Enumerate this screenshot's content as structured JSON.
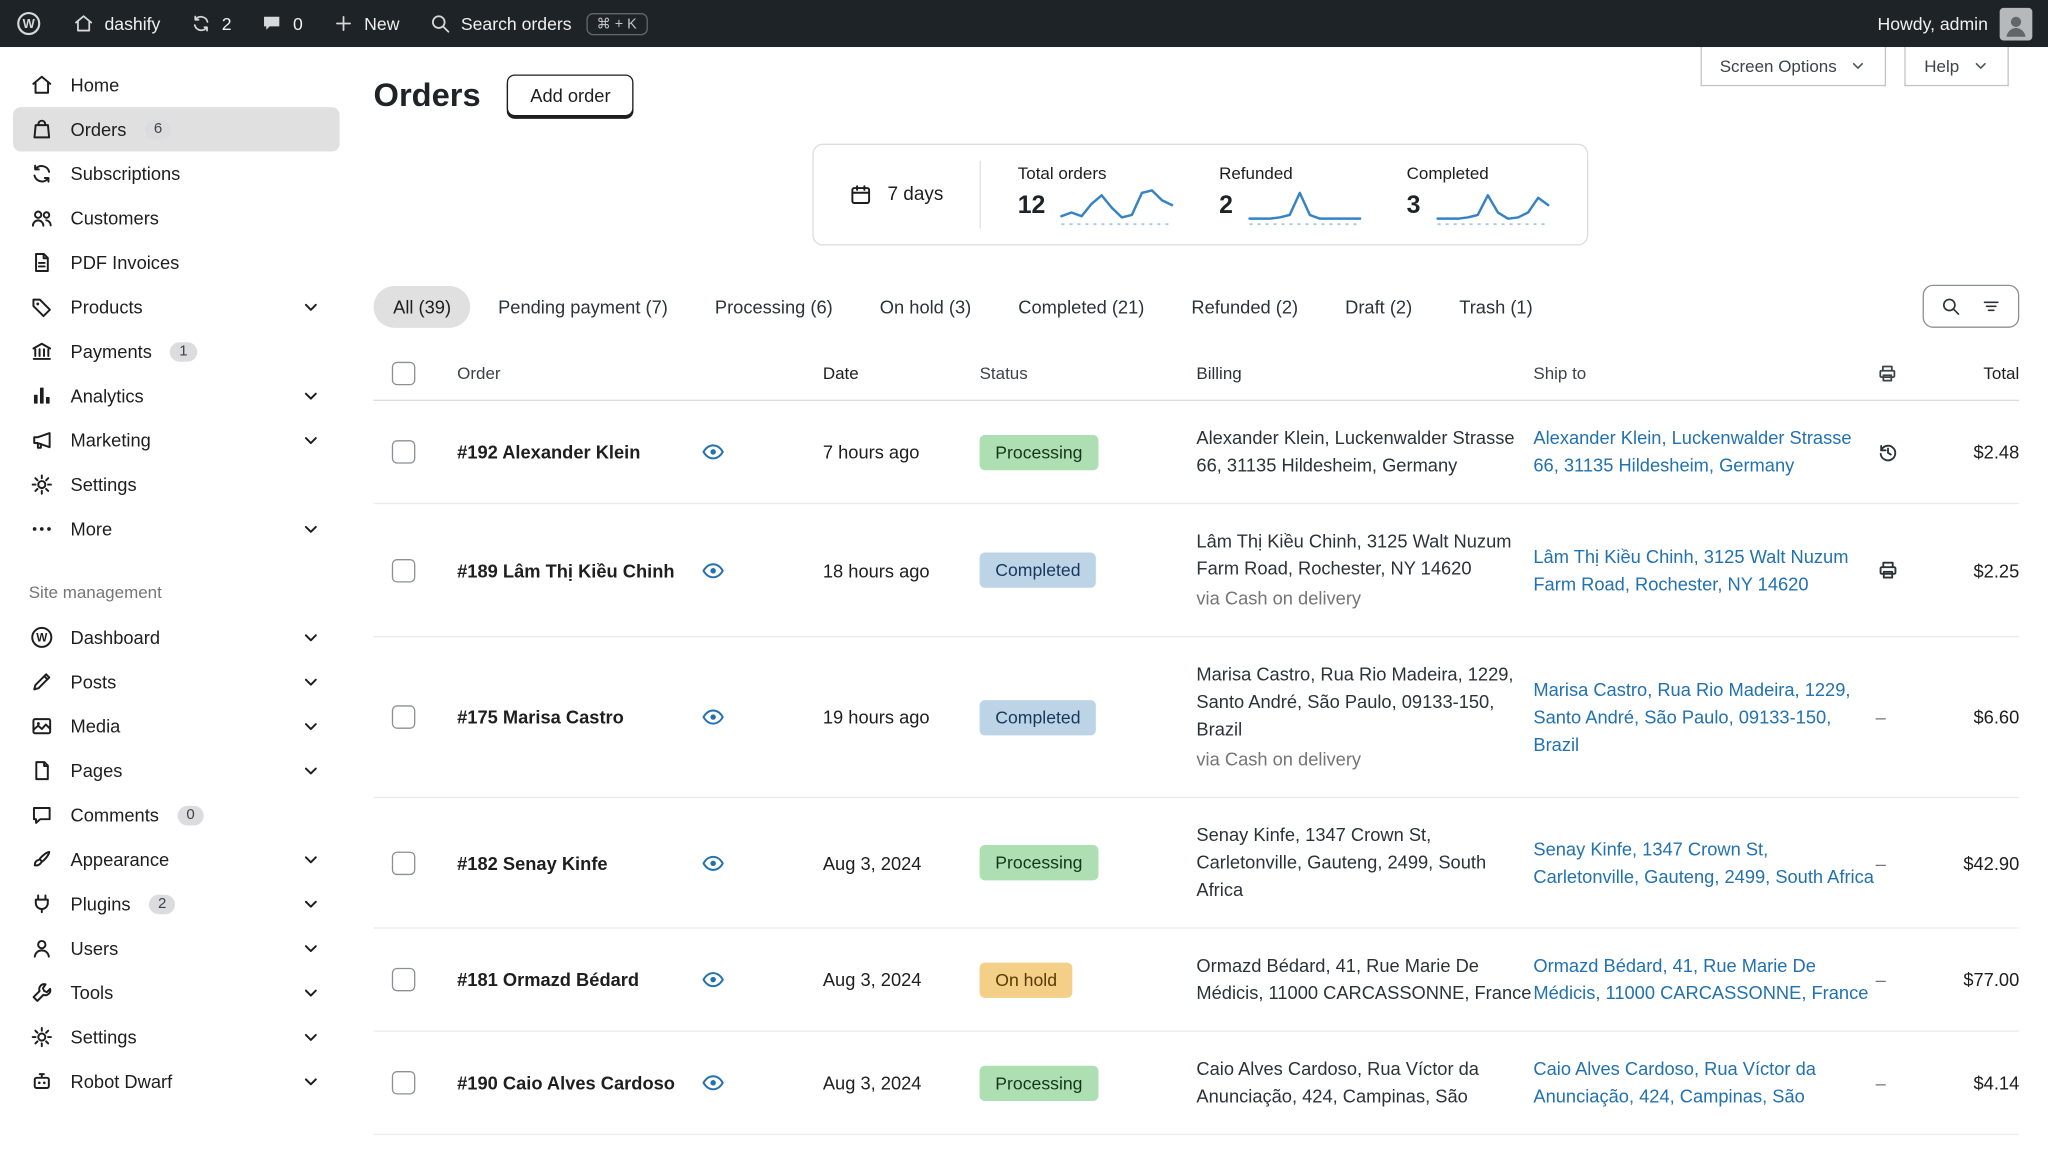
{
  "admin_bar": {
    "site_name": "dashify",
    "updates_count": "2",
    "comments_count": "0",
    "new_label": "New",
    "search_label": "Search orders",
    "search_shortcut": "⌘ + K",
    "howdy_label": "Howdy, admin"
  },
  "sidebar": {
    "items": [
      {
        "label": "Home",
        "icon": "home"
      },
      {
        "label": "Orders",
        "icon": "orders",
        "badge": "6",
        "active": true
      },
      {
        "label": "Subscriptions",
        "icon": "subscriptions"
      },
      {
        "label": "Customers",
        "icon": "customers"
      },
      {
        "label": "PDF Invoices",
        "icon": "pdf-invoices"
      },
      {
        "label": "Products",
        "icon": "products",
        "chevron": true
      },
      {
        "label": "Payments",
        "icon": "payments",
        "badge": "1"
      },
      {
        "label": "Analytics",
        "icon": "analytics",
        "chevron": true
      },
      {
        "label": "Marketing",
        "icon": "marketing",
        "chevron": true
      },
      {
        "label": "Settings",
        "icon": "settings"
      },
      {
        "label": "More",
        "icon": "more",
        "chevron": true
      }
    ],
    "section_label": "Site management",
    "site_items": [
      {
        "label": "Dashboard",
        "icon": "wordpress",
        "chevron": true
      },
      {
        "label": "Posts",
        "icon": "posts",
        "chevron": true
      },
      {
        "label": "Media",
        "icon": "media",
        "chevron": true
      },
      {
        "label": "Pages",
        "icon": "pages",
        "chevron": true
      },
      {
        "label": "Comments",
        "icon": "comments",
        "badge": "0"
      },
      {
        "label": "Appearance",
        "icon": "appearance",
        "chevron": true
      },
      {
        "label": "Plugins",
        "icon": "plugins",
        "badge": "2",
        "chevron": true
      },
      {
        "label": "Users",
        "icon": "users",
        "chevron": true
      },
      {
        "label": "Tools",
        "icon": "tools",
        "chevron": true
      },
      {
        "label": "Settings",
        "icon": "settings",
        "chevron": true
      },
      {
        "label": "Robot Dwarf",
        "icon": "robot",
        "chevron": true
      }
    ]
  },
  "header": {
    "title": "Orders",
    "add_order_label": "Add order",
    "screen_options_label": "Screen Options",
    "help_label": "Help"
  },
  "stats": {
    "period_label": "7 days",
    "spark_color": "#3582c4",
    "baseline_color": "#a8c8e8",
    "cards": [
      {
        "label": "Total orders",
        "value": "12",
        "spark": [
          25,
          22,
          25,
          15,
          8,
          18,
          26,
          24,
          6,
          4,
          12,
          16
        ]
      },
      {
        "label": "Refunded",
        "value": "2",
        "spark": [
          27,
          27,
          27,
          26,
          24,
          6,
          24,
          27,
          27,
          27,
          27,
          27
        ]
      },
      {
        "label": "Completed",
        "value": "3",
        "spark": [
          27,
          27,
          27,
          26,
          24,
          8,
          22,
          27,
          26,
          22,
          10,
          16
        ]
      }
    ]
  },
  "filters": {
    "tabs": [
      {
        "label": "All (39)",
        "active": true
      },
      {
        "label": "Pending payment (7)"
      },
      {
        "label": "Processing (6)"
      },
      {
        "label": "On hold (3)"
      },
      {
        "label": "Completed (21)"
      },
      {
        "label": "Refunded (2)"
      },
      {
        "label": "Draft (2)"
      },
      {
        "label": "Trash (1)"
      }
    ]
  },
  "status_colors": {
    "processing": {
      "bg": "#aedfb2",
      "fg": "#14361a"
    },
    "completed": {
      "bg": "#bdd4e7",
      "fg": "#17385c"
    },
    "on-hold": {
      "bg": "#f3cf87",
      "fg": "#573b00"
    }
  },
  "table": {
    "empty_cell": "–",
    "headers": {
      "order": "Order",
      "date": "Date",
      "status": "Status",
      "billing": "Billing",
      "ship_to": "Ship to",
      "total": "Total"
    },
    "rows": [
      {
        "order": "#192 Alexander Klein",
        "date": "7 hours ago",
        "status": "Processing",
        "status_key": "processing",
        "billing": "Alexander Klein, Luckenwalder Strasse 66, 31135 Hildesheim, Germany",
        "billing_note": "",
        "ship_to": "Alexander Klein, Luckenwalder Strasse 66, 31135 Hildesheim, Germany",
        "doc_icon": "history",
        "total": "$2.48"
      },
      {
        "order": "#189 Lâm Thị Kiều Chinh",
        "date": "18 hours ago",
        "status": "Completed",
        "status_key": "completed",
        "billing": "Lâm Thị Kiều Chinh, 3125 Walt Nuzum Farm Road, Rochester, NY 14620",
        "billing_note": "via Cash on delivery",
        "ship_to": "Lâm Thị Kiều Chinh, 3125 Walt Nuzum Farm Road, Rochester, NY 14620",
        "doc_icon": "printer",
        "total": "$2.25"
      },
      {
        "order": "#175 Marisa Castro",
        "date": "19 hours ago",
        "status": "Completed",
        "status_key": "completed",
        "billing": "Marisa Castro, Rua Rio Madeira, 1229, Santo André, São Paulo, 09133-150, Brazil",
        "billing_note": "via Cash on delivery",
        "ship_to": "Marisa Castro, Rua Rio Madeira, 1229, Santo André, São Paulo, 09133-150, Brazil",
        "doc_icon": "dash",
        "total": "$6.60"
      },
      {
        "order": "#182 Senay Kinfe",
        "date": "Aug 3, 2024",
        "status": "Processing",
        "status_key": "processing",
        "billing": "Senay Kinfe, 1347 Crown St, Carletonville, Gauteng, 2499, South Africa",
        "billing_note": "",
        "ship_to": "Senay Kinfe, 1347 Crown St, Carletonville, Gauteng, 2499, South Africa",
        "doc_icon": "dash",
        "total": "$42.90"
      },
      {
        "order": "#181 Ormazd Bédard",
        "date": "Aug 3, 2024",
        "status": "On hold",
        "status_key": "on-hold",
        "billing": "Ormazd Bédard, 41, Rue Marie De Médicis, 11000 CARCASSONNE, France",
        "billing_note": "",
        "ship_to": "Ormazd Bédard, 41, Rue Marie De Médicis, 11000 CARCASSONNE, France",
        "doc_icon": "dash",
        "total": "$77.00"
      },
      {
        "order": "#190 Caio Alves Cardoso",
        "date": "Aug 3, 2024",
        "status": "Processing",
        "status_key": "processing",
        "billing": "Caio Alves Cardoso, Rua Víctor da Anunciação, 424, Campinas, São",
        "billing_note": "",
        "ship_to": "Caio Alves Cardoso, Rua Víctor da Anunciação, 424, Campinas, São",
        "doc_icon": "dash",
        "total": "$4.14"
      }
    ]
  }
}
